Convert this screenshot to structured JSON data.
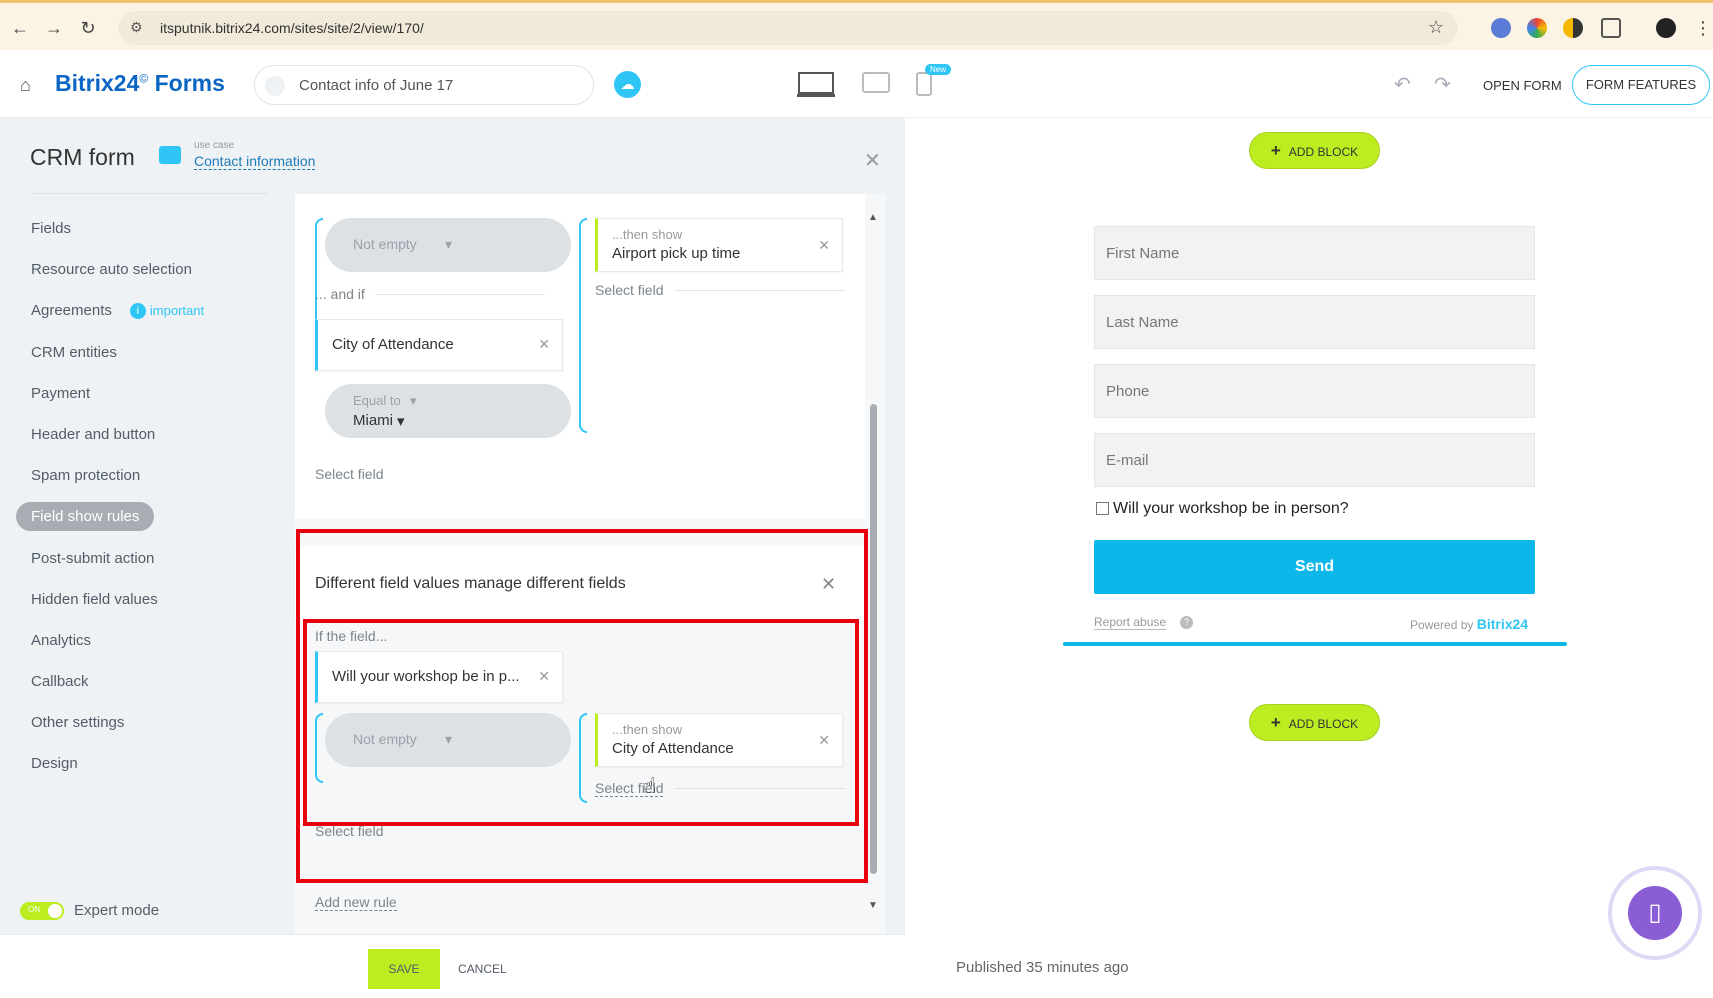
{
  "browser": {
    "url": "itsputnik.bitrix24.com/sites/site/2/view/170/"
  },
  "header": {
    "brand_name": "Bitrix24",
    "brand_suffix": "Forms",
    "form_name": "Contact info of June 17",
    "new_badge": "New",
    "open_form": "OPEN FORM",
    "form_features": "FORM FEATURES"
  },
  "panel": {
    "title": "CRM form",
    "use_case_label": "use case",
    "use_case_value": "Contact information",
    "menu": [
      {
        "label": "Fields"
      },
      {
        "label": "Resource auto selection"
      },
      {
        "label": "Agreements",
        "badge": "important"
      },
      {
        "label": "CRM entities"
      },
      {
        "label": "Payment"
      },
      {
        "label": "Header and button"
      },
      {
        "label": "Spam protection"
      },
      {
        "label": "Field show rules",
        "active": true
      },
      {
        "label": "Post-submit action"
      },
      {
        "label": "Hidden field values"
      },
      {
        "label": "Analytics"
      },
      {
        "label": "Callback"
      },
      {
        "label": "Other settings"
      },
      {
        "label": "Design"
      }
    ],
    "expert_mode": "Expert mode",
    "toggle_text": "ON"
  },
  "rules": {
    "rule1": {
      "condition1": "Not empty",
      "then_show_label": "...then show",
      "then_show_field": "Airport pick up time",
      "select_field": "Select field",
      "and_if": "... and if",
      "field2": "City of Attendance",
      "condition2_label": "Equal to",
      "condition2_value": "Miami",
      "select_field_bottom": "Select field"
    },
    "rule2": {
      "title": "Different field values manage different fields",
      "if_the_field": "If the field...",
      "field": "Will your workshop be in p...",
      "condition": "Not empty",
      "then_show_label": "...then show",
      "then_show_field": "City of Attendance",
      "select_field_right": "Select field",
      "select_field_bottom": "Select field"
    },
    "add_new_rule": "Add new rule"
  },
  "footer": {
    "save": "SAVE",
    "cancel": "CANCEL"
  },
  "preview": {
    "add_block": "ADD BLOCK",
    "fields": [
      "First Name",
      "Last Name",
      "Phone",
      "E-mail"
    ],
    "checkbox_label": "Will your workshop be in person?",
    "send": "Send",
    "report_abuse": "Report abuse",
    "powered_by": "Powered by",
    "powered_brand": "Bitrix24",
    "published": "Published 35 minutes ago"
  },
  "colors": {
    "accent": "#2fc6f6",
    "green": "#bbed21",
    "highlight_red": "#e8000f",
    "send_button": "#0cb7ea"
  }
}
